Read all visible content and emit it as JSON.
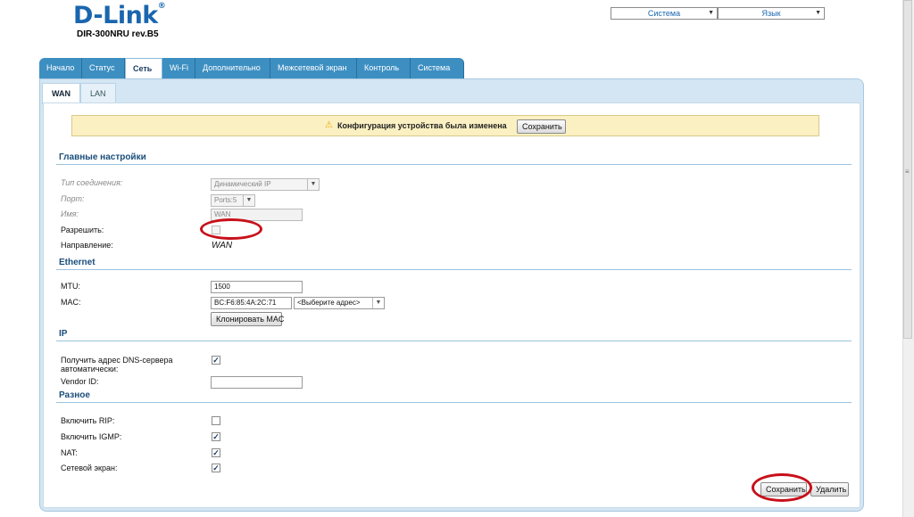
{
  "header": {
    "logo": "D-Link",
    "logo_mark": "®",
    "model": "DIR-300NRU rev.B5",
    "system_select": "Система",
    "language_select": "Язык"
  },
  "tabs": [
    "Начало",
    "Статус",
    "Сеть",
    "Wi-Fi",
    "Дополнительно",
    "Межсетевой экран",
    "Контроль",
    "Система"
  ],
  "active_tab": "Сеть",
  "subtabs": [
    "WAN",
    "LAN"
  ],
  "active_subtab": "WAN",
  "warning": {
    "icon": "warning-icon",
    "text": "Конфигурация устройства была изменена",
    "button": "Сохранить"
  },
  "main": {
    "title": "Главные настройки",
    "connection_type_label": "Тип соединения:",
    "connection_type_value": "Динамический IP",
    "port_label": "Порт:",
    "port_value": "Ports:5",
    "name_label": "Имя:",
    "name_value": "WAN",
    "allow_label": "Разрешить:",
    "allow_checked": false,
    "direction_label": "Направление:",
    "direction_value": "WAN"
  },
  "ethernet": {
    "title": "Ethernet",
    "mtu_label": "MTU:",
    "mtu_value": "1500",
    "mac_label": "MAC:",
    "mac_value": "BC:F6:85:4A:2C:71",
    "mac_select": "<Выберите адрес>",
    "clone_button": "Клонировать MAC"
  },
  "ip": {
    "title": "IP",
    "dns_label_line1": "Получить адрес DNS-сервера",
    "dns_label_line2": "автоматически:",
    "dns_checked": true,
    "vendor_label": "Vendor ID:",
    "vendor_value": ""
  },
  "misc": {
    "title": "Разное",
    "rip_label": "Включить RIP:",
    "rip_checked": false,
    "igmp_label": "Включить IGMP:",
    "igmp_checked": true,
    "nat_label": "NAT:",
    "nat_checked": true,
    "firewall_label": "Сетевой экран:",
    "firewall_checked": true
  },
  "actions": {
    "save": "Сохранить",
    "delete": "Удалить"
  },
  "colors": {
    "tab_blue": "#3d8fc2",
    "logo_blue": "#1a66ae",
    "section_blue": "#1a4d7a",
    "annotation_red": "#c8101a",
    "warning_bg": "#fbf0c2"
  }
}
